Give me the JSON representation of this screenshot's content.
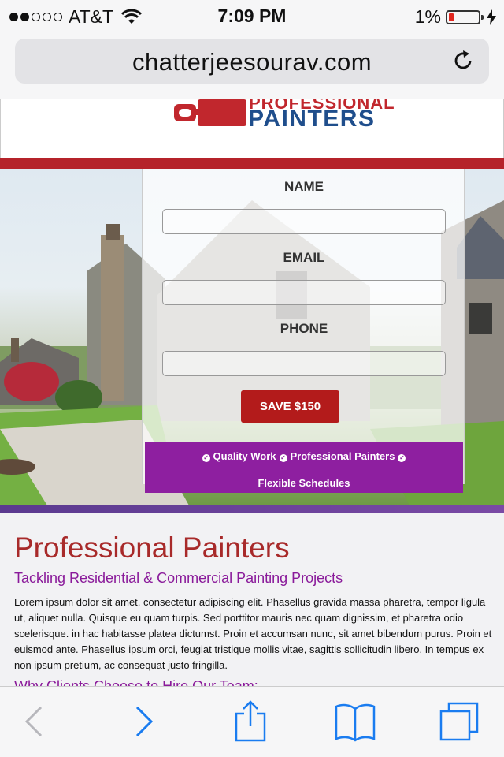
{
  "status_bar": {
    "carrier": "AT&T",
    "time": "7:09 PM",
    "battery": "1%",
    "battery_level": 0.01,
    "signal_bars": 2
  },
  "browser": {
    "url": "chatterjeesourav.com"
  },
  "logo": {
    "line1": "PROFESSIONAL",
    "line2": "PAINTERS"
  },
  "form": {
    "name_label": "NAME",
    "email_label": "EMAIL",
    "phone_label": "PHONE",
    "submit_label": "SAVE $150",
    "features_line1": [
      "Quality Work",
      "Professional Painters"
    ],
    "features_line2": "Flexible Schedules"
  },
  "content": {
    "heading": "Professional Painters",
    "subheading": "Tackling Residential & Commercial Painting Projects",
    "paragraph": "Lorem ipsum dolor sit amet, consectetur adipiscing elit. Phasellus gravida massa pharetra, tempor ligula ut, aliquet nulla. Quisque eu quam turpis. Sed porttitor mauris nec quam dignissim, et pharetra odio scelerisque. in hac habitasse platea dictumst. Proin et accumsan nunc, sit amet bibendum purus. Proin et euismod ante. Phasellus ipsum orci, feugiat tristique mollis vitae, sagittis sollicitudin libero. In tempus ex non ipsum pretium, ac consequat justo fringilla.",
    "section_heading": "Why Clients Choose to Hire Our Team:"
  },
  "colors": {
    "brand_red": "#b5232a",
    "brand_blue": "#1f4e8c",
    "banner_purple": "#8e1fa0",
    "ios_blue": "#1a7cf0"
  },
  "toolbar": {
    "icons": [
      "back-icon",
      "forward-icon",
      "share-icon",
      "bookmarks-icon",
      "tabs-icon"
    ]
  }
}
